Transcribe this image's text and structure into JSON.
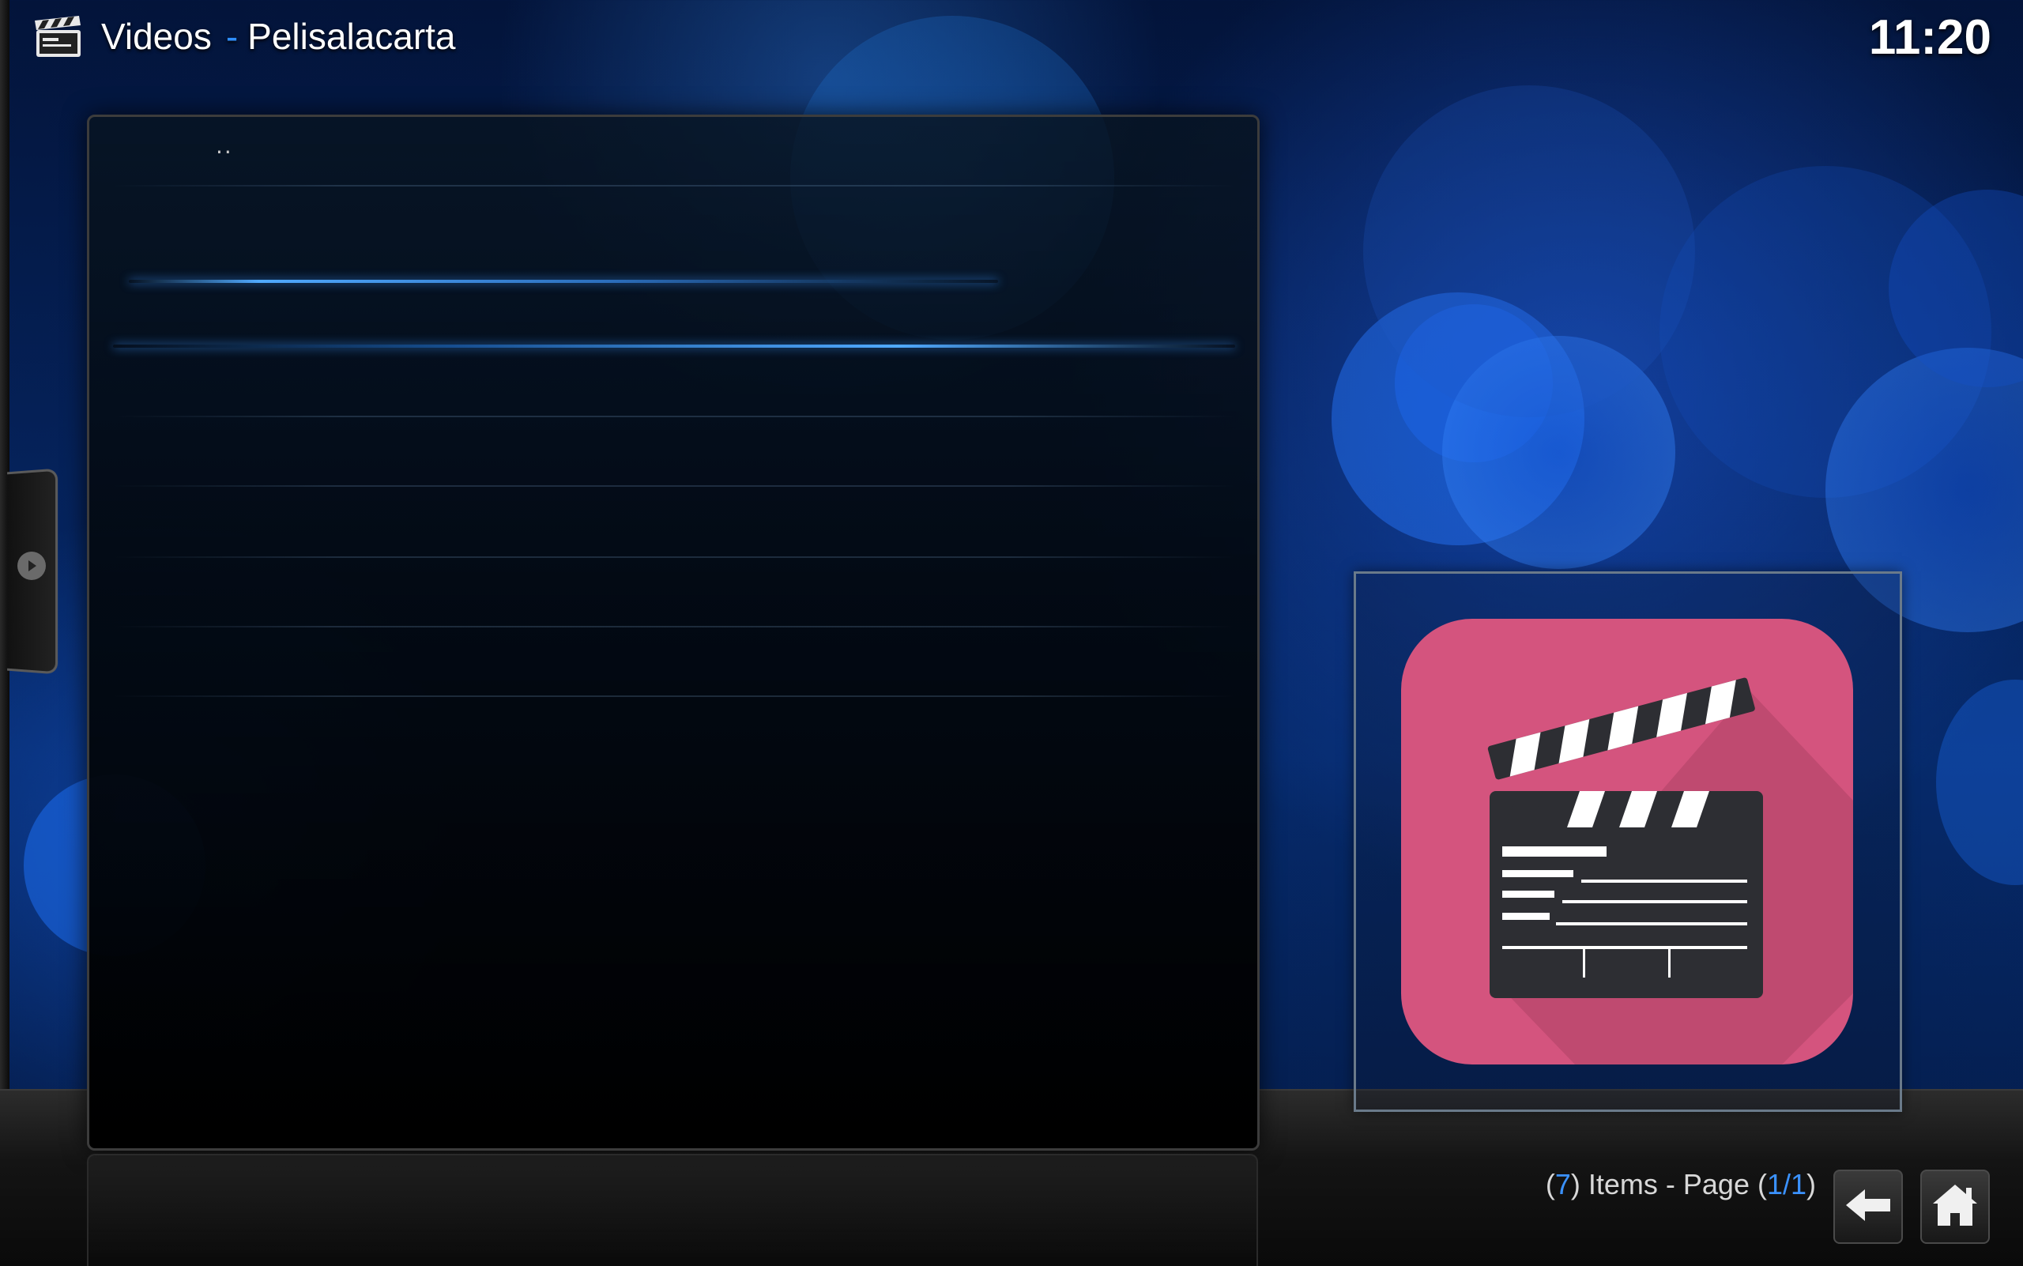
{
  "header": {
    "section": "Videos",
    "separator": "-",
    "location": "Pelisalacarta",
    "icon": "clapperboard-icon"
  },
  "clock": "11:20",
  "side_tab": {
    "icon": "chevron-right-icon"
  },
  "list": {
    "items": [
      {
        "label": ".."
      },
      {
        "label": ""
      },
      {
        "label": ""
      },
      {
        "label": ""
      },
      {
        "label": ""
      },
      {
        "label": ""
      },
      {
        "label": ""
      },
      {
        "label": ""
      }
    ]
  },
  "thumbnail": {
    "icon": "clapperboard-icon",
    "background": "#d4547e"
  },
  "footer": {
    "open_paren": "(",
    "count": "7",
    "items_text": ") Items - Page (",
    "page": "1/1",
    "close_paren": ")",
    "back_icon": "back-arrow-icon",
    "home_icon": "home-icon"
  },
  "colors": {
    "accent": "#3b92ff",
    "focus_line": "#50aaff",
    "thumb_bg": "#d4547e"
  }
}
